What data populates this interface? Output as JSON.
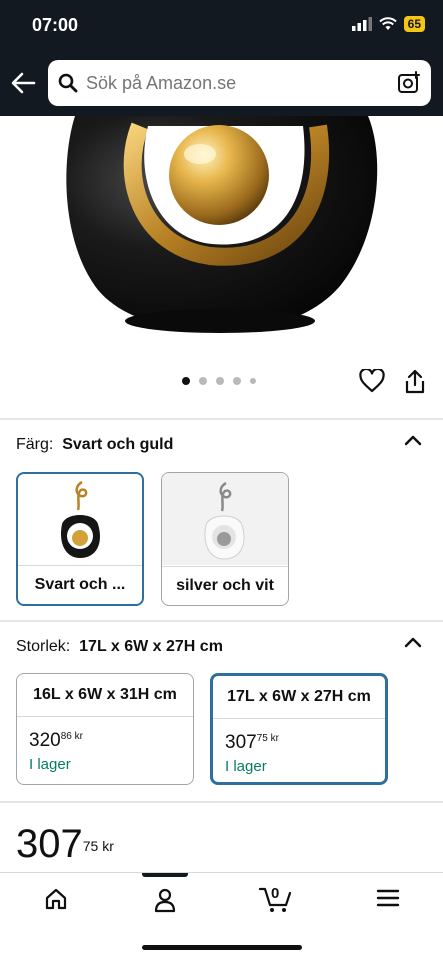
{
  "status": {
    "time": "07:00",
    "battery": "65"
  },
  "search": {
    "placeholder": "Sök på Amazon.se"
  },
  "gallery": {
    "dots": 5,
    "active_index": 0
  },
  "color": {
    "label": "Färg:",
    "selected": "Svart och guld",
    "options": [
      {
        "label": "Svart och ...",
        "selected": true
      },
      {
        "label": "silver och vit",
        "selected": false
      }
    ]
  },
  "size": {
    "label": "Storlek:",
    "selected": "17L x 6W x 27H cm",
    "options": [
      {
        "title": "16L x 6W x 31H cm",
        "price_whole": "320",
        "price_fraction": "86",
        "currency": "kr",
        "stock": "I lager",
        "selected": false
      },
      {
        "title": "17L x 6W x 27H cm",
        "price_whole": "307",
        "price_fraction": "75",
        "currency": "kr",
        "stock": "I lager",
        "selected": true
      }
    ]
  },
  "price": {
    "whole": "307",
    "fraction": "75",
    "currency": "kr"
  },
  "nav": {
    "cart_count": "0",
    "items": [
      "home-icon",
      "account-icon",
      "cart-icon",
      "menu-icon"
    ]
  },
  "colors": {
    "topbar": "#131921",
    "selected_border": "#2f6f9f",
    "in_stock": "#067d62"
  }
}
